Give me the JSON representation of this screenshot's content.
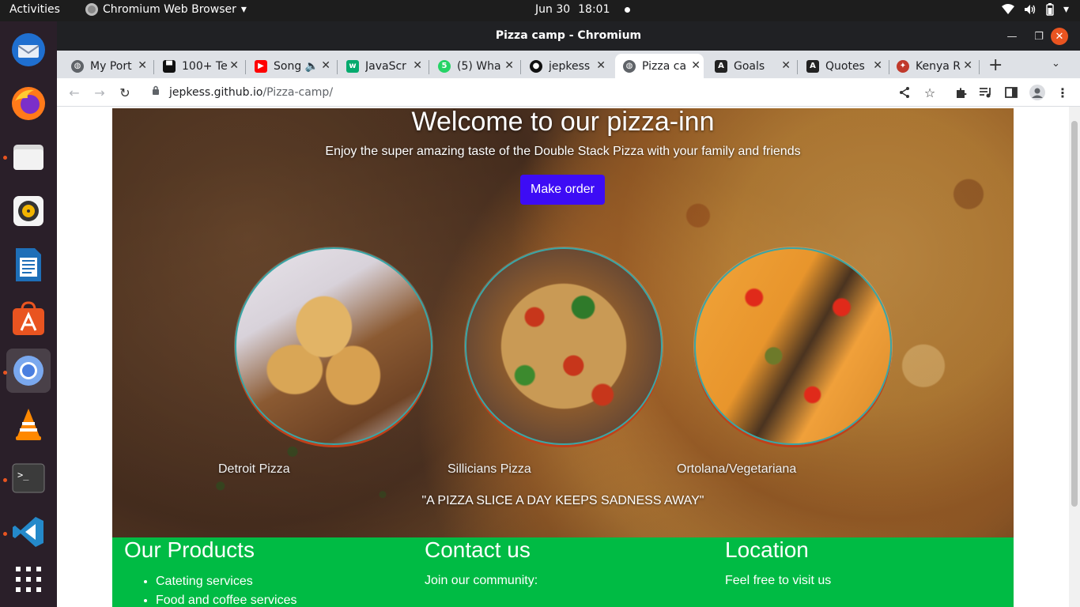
{
  "system": {
    "activities": "Activities",
    "app_menu": "Chromium Web Browser",
    "date": "Jun 30",
    "time": "18:01"
  },
  "dock": {
    "items": [
      "thunderbird-icon",
      "firefox-icon",
      "files-icon",
      "rhythmbox-icon",
      "libreoffice-writer-icon",
      "app-center-icon",
      "chromium-icon",
      "vlc-icon",
      "terminal-icon",
      "vscode-icon",
      "show-apps-icon"
    ]
  },
  "window": {
    "title": "Pizza camp - Chromium"
  },
  "tabs": [
    {
      "label": "My Port",
      "favicon": "globe-icon"
    },
    {
      "label": "100+ Te",
      "favicon": "site-icon"
    },
    {
      "label": "Song",
      "favicon": "youtube-icon"
    },
    {
      "label": "JavaScr",
      "favicon": "w3-icon"
    },
    {
      "label": "(5) Wha",
      "favicon": "whatsapp-icon"
    },
    {
      "label": "jepkess",
      "favicon": "github-icon"
    },
    {
      "label": "Pizza ca",
      "favicon": "globe-icon",
      "active": true
    },
    {
      "label": "Goals",
      "favicon": "angular-icon"
    },
    {
      "label": "Quotes",
      "favicon": "angular-icon"
    },
    {
      "label": "Kenya R",
      "favicon": "kenya-icon"
    }
  ],
  "address": {
    "host": "jepkess.github.io",
    "path": "/Pizza-camp/"
  },
  "hero": {
    "title": "Welcome to our pizza-inn",
    "subtitle": "Enjoy the super amazing taste of the Double Stack Pizza with your family and friends",
    "button": "Make order",
    "pizzas": [
      "Detroit Pizza",
      "Sillicians Pizza",
      "Ortolana/Vegetariana"
    ],
    "quote": "\"A PIZZA SLICE A DAY KEEPS SADNESS AWAY\""
  },
  "footer": {
    "products": {
      "heading": "Our Products",
      "items": [
        "Cateting services",
        "Food and coffee services"
      ]
    },
    "contact": {
      "heading": "Contact us",
      "text": "Join our community:"
    },
    "location": {
      "heading": "Location",
      "text": "Feel free to visit us"
    }
  },
  "colors": {
    "order_button": "#3d0cf5",
    "footer_bg": "#00bb44",
    "close_button": "#e95420"
  }
}
